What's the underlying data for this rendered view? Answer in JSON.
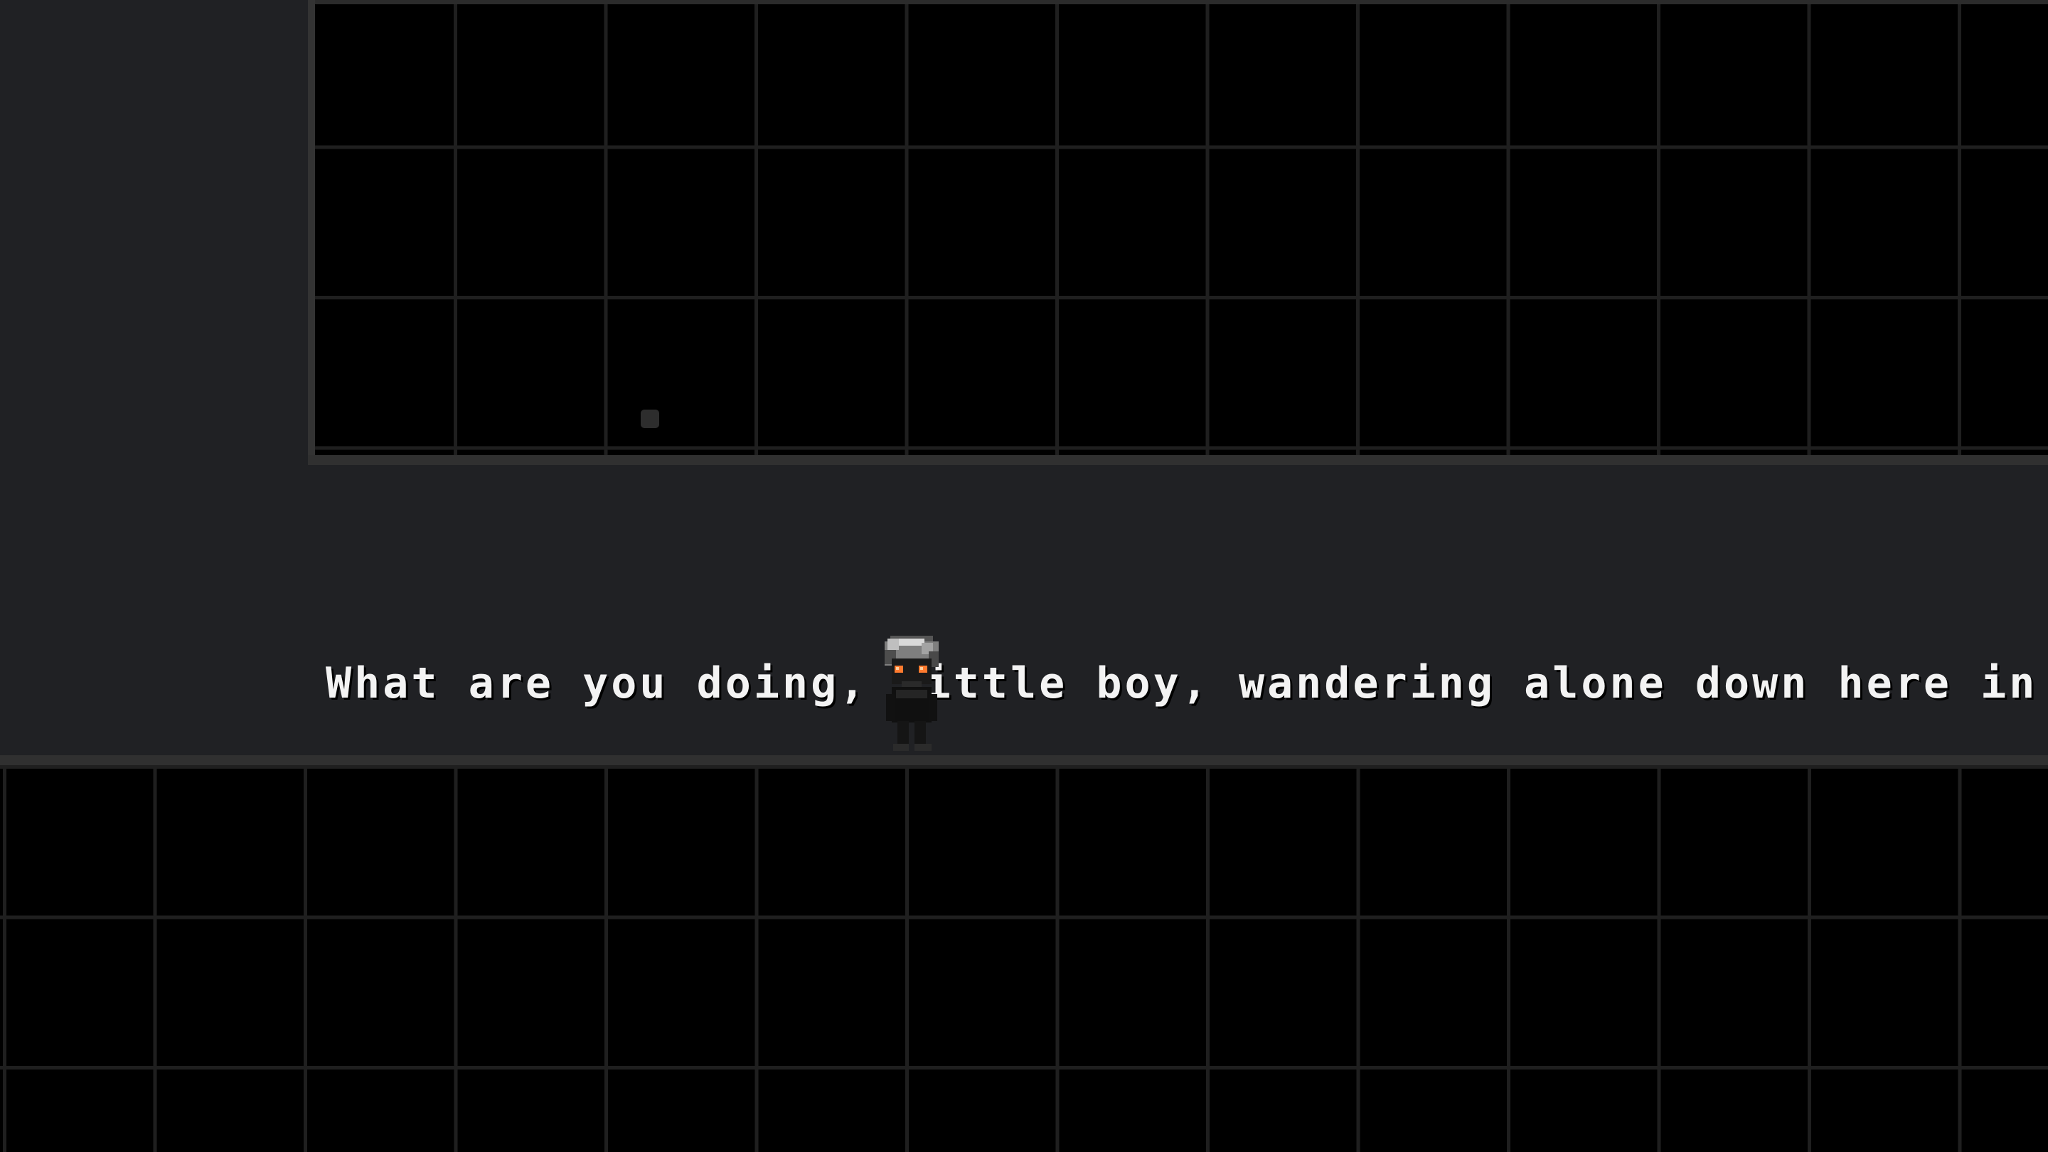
{
  "scene": {
    "dialogue": "What are you doing, little boy, wandering alone down here in t"
  },
  "character": {
    "description_icon": "dark-haired-child-sprite",
    "eye_color": "#ff7b2f"
  },
  "colors": {
    "background": "#202124",
    "panel": "#000000",
    "grid_line": "#1f1f1f",
    "text": "#f3f3f3"
  }
}
